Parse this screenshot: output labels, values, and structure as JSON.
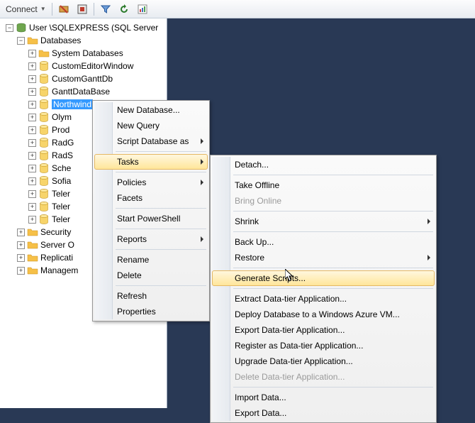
{
  "toolbar": {
    "connect_label": "Connect"
  },
  "tree": {
    "root": "User      \\SQLEXPRESS (SQL Server",
    "databases": "Databases",
    "system_db": "System Databases",
    "items": [
      "CustomEditorWindow",
      "CustomGanttDb",
      "GanttDataBase",
      "Northwind",
      "Olym",
      "Prod",
      "RadG",
      "RadS",
      "Sche",
      "Sofia",
      "Teler",
      "Teler",
      "Teler"
    ],
    "folders": [
      "Security",
      "Server O",
      "Replicati",
      "Managem"
    ]
  },
  "ctx1": {
    "new_db": "New Database...",
    "new_query": "New Query",
    "script_db": "Script Database as",
    "tasks": "Tasks",
    "policies": "Policies",
    "facets": "Facets",
    "powershell": "Start PowerShell",
    "reports": "Reports",
    "rename": "Rename",
    "delete": "Delete",
    "refresh": "Refresh",
    "properties": "Properties"
  },
  "ctx2": {
    "detach": "Detach...",
    "offline": "Take Offline",
    "online": "Bring Online",
    "shrink": "Shrink",
    "backup": "Back Up...",
    "restore": "Restore",
    "gen_scripts": "Generate Scripts...",
    "extract": "Extract Data-tier Application...",
    "deploy_azure": "Deploy Database to a Windows Azure VM...",
    "export_dt": "Export Data-tier Application...",
    "register": "Register as Data-tier Application...",
    "upgrade": "Upgrade Data-tier Application...",
    "delete_dt": "Delete Data-tier Application...",
    "import": "Import Data...",
    "export": "Export Data..."
  }
}
